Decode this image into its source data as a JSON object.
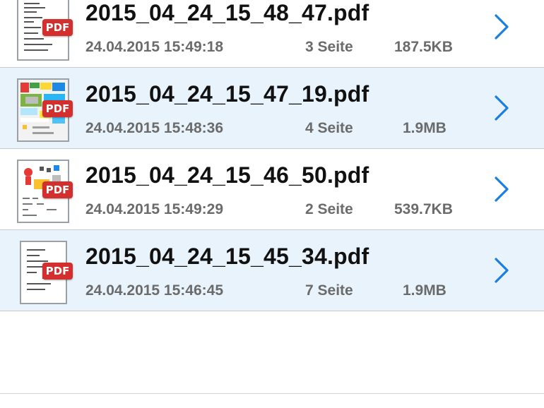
{
  "files": [
    {
      "name": "2015_04_24_15_48_47.pdf",
      "date": "24.04.2015 15:49:18",
      "pages": "3 Seite",
      "size": "187.5KB",
      "badge": "PDF",
      "thumbnail": "text-document",
      "chevron_icon": "chevron-right-icon"
    },
    {
      "name": "2015_04_24_15_47_19.pdf",
      "date": "24.04.2015 15:48:36",
      "pages": "4 Seite",
      "size": "1.9MB",
      "badge": "PDF",
      "thumbnail": "colorful-brochure",
      "chevron_icon": "chevron-right-icon"
    },
    {
      "name": "2015_04_24_15_46_50.pdf",
      "date": "24.04.2015 15:49:29",
      "pages": "2 Seite",
      "size": "539.7KB",
      "badge": "PDF",
      "thumbnail": "illustrated-page",
      "chevron_icon": "chevron-right-icon"
    },
    {
      "name": "2015_04_24_15_45_34.pdf",
      "date": "24.04.2015 15:46:45",
      "pages": "7 Seite",
      "size": "1.9MB",
      "badge": "PDF",
      "thumbnail": "text-document",
      "chevron_icon": "chevron-right-icon"
    }
  ],
  "colors": {
    "row_alt_background": "#e8f3fb",
    "pdf_badge": "#d32f2f",
    "chevron": "#1a7fe0",
    "meta_text": "#6b6b6b"
  }
}
